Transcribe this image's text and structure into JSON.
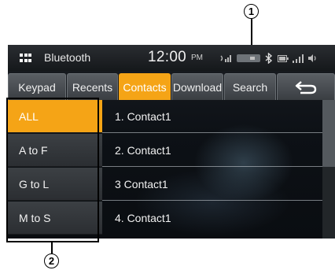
{
  "callouts": {
    "one": "1",
    "two": "2"
  },
  "status_bar": {
    "title": "Bluetooth",
    "time": "12:00",
    "ampm": "PM",
    "icons": [
      "grid-menu-icon",
      "phone-signal-icon",
      "battery-pill-icon",
      "bluetooth-icon",
      "battery-icon",
      "signal-bars-icon",
      "volume-icon"
    ]
  },
  "tabs": [
    "Keypad",
    "Recents",
    "Contacts",
    "Download",
    "Search"
  ],
  "active_tab": "Contacts",
  "index_list": [
    "ALL",
    "A to F",
    "G to L",
    "M to S"
  ],
  "active_index": "ALL",
  "contacts": [
    "1. Contact1",
    "2. Contact1",
    "3 Contact1",
    "4. Contact1"
  ],
  "colors": {
    "accent": "#f5a416",
    "screen_bg": "#0b0f14",
    "tab_bg": "#4a4e52"
  }
}
